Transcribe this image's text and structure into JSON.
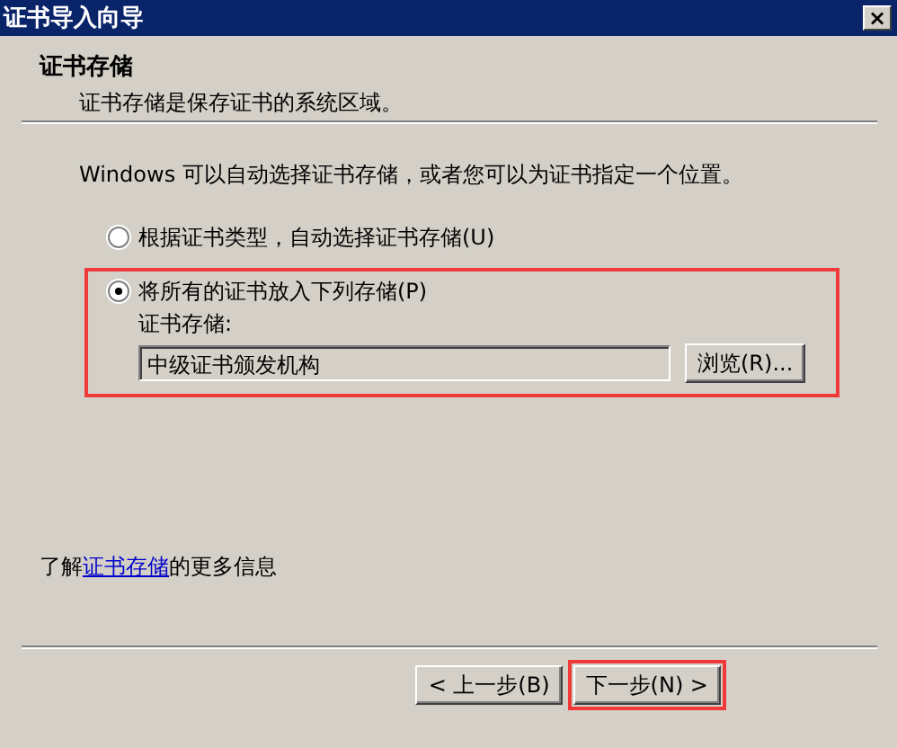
{
  "window": {
    "title": "证书导入向导",
    "close": "×"
  },
  "header": {
    "title": "证书存储",
    "subtitle": "证书存储是保存证书的系统区域。"
  },
  "instruction": "Windows 可以自动选择证书存储，或者您可以为证书指定一个位置。",
  "options": [
    {
      "label": "根据证书类型，自动选择证书存储(U)",
      "selected": false,
      "highlighted": false
    },
    {
      "label": "将所有的证书放入下列存储(P)",
      "selected": true,
      "highlighted": true
    }
  ],
  "store": {
    "label": "证书存储:",
    "value": "中级证书颁发机构",
    "browse": "浏览(R)..."
  },
  "more_info": {
    "before": "了解",
    "link": "证书存储",
    "after": "的更多信息"
  },
  "buttons": [
    {
      "label": "< 上一步(B)",
      "highlighted": false
    },
    {
      "label": "下一步(N) >",
      "highlighted": true
    }
  ]
}
